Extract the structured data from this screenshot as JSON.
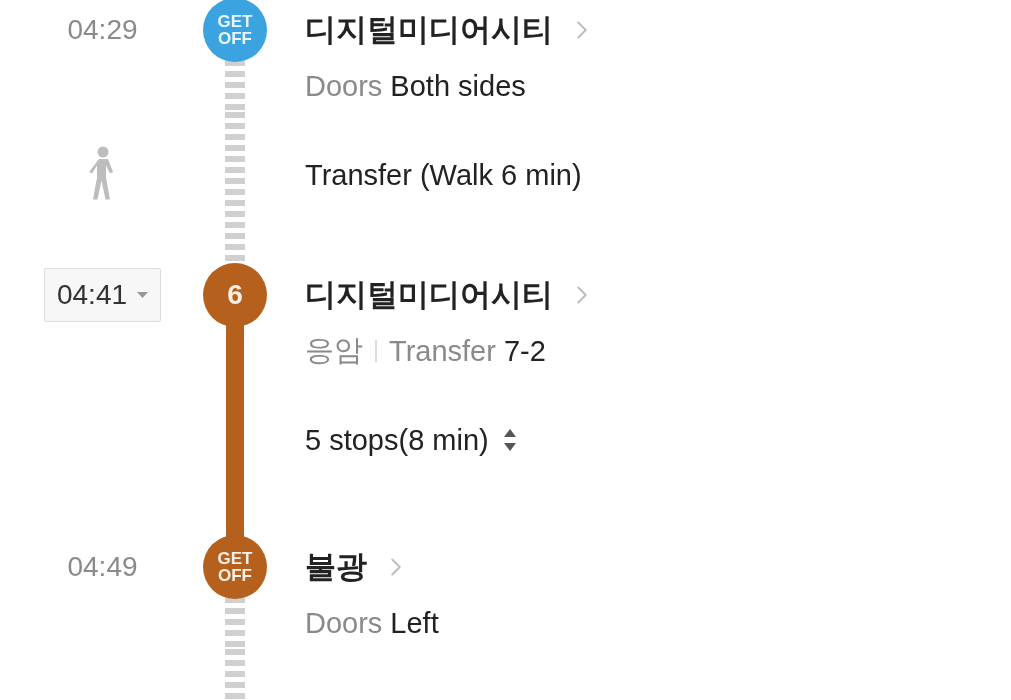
{
  "timeline": [
    {
      "kind": "stop",
      "time": "04:29",
      "time_editable": false,
      "marker": {
        "kind": "get_off",
        "lines": [
          "GET",
          "OFF"
        ]
      },
      "color": "#3ba3e0",
      "name": "디지털미디어시티",
      "info": [
        [
          {
            "text": "Doors",
            "muted": true
          },
          {
            "text": "Both sides",
            "muted": false
          }
        ]
      ],
      "dashed_below": true
    },
    {
      "kind": "walk",
      "text": "Transfer (Walk 6 min)"
    },
    {
      "kind": "stop",
      "time": "04:41",
      "time_editable": true,
      "marker": {
        "kind": "line",
        "lines": [
          "6"
        ]
      },
      "color": "#b5601c",
      "name": "디지털미디어시티",
      "info": [
        [
          {
            "text": "응암",
            "muted": true
          }
        ],
        [
          {
            "text": "Transfer",
            "muted": true
          },
          {
            "text": "7-2",
            "muted": false
          }
        ]
      ],
      "dashed_below": false
    },
    {
      "kind": "ride",
      "text": "5 stops(8 min)"
    },
    {
      "kind": "stop",
      "time": "04:49",
      "time_editable": false,
      "marker": {
        "kind": "get_off",
        "lines": [
          "GET",
          "OFF"
        ]
      },
      "color": "#b5601c",
      "name": "불광",
      "info": [
        [
          {
            "text": "Doors",
            "muted": true
          },
          {
            "text": "Left",
            "muted": false
          }
        ]
      ],
      "dashed_below": true
    }
  ]
}
